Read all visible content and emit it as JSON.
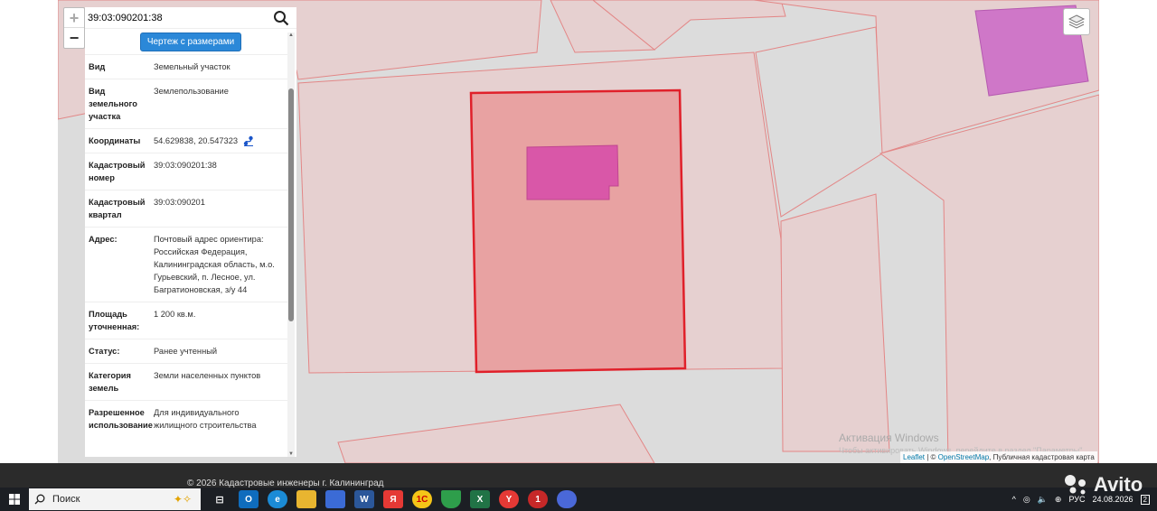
{
  "search": {
    "value": "39:03:090201:38"
  },
  "drawing_button": "Чертеж с размерами",
  "info_rows": [
    {
      "key": "Вид",
      "value": "Земельный участок"
    },
    {
      "key": "Вид земельного участка",
      "value": "Землепользование"
    },
    {
      "key": "Координаты",
      "value": "54.629838, 20.547323"
    },
    {
      "key": "Кадастровый номер",
      "value": "39:03:090201:38"
    },
    {
      "key": "Кадастровый квартал",
      "value": "39:03:090201"
    },
    {
      "key": "Адрес:",
      "value": "Почтовый адрес ориентира: Российская Федерация, Калининградская область, м.о. Гурьевский, п. Лесное, ул. Багратионовская, з/у 44"
    },
    {
      "key": "Площадь уточненная:",
      "value": "1 200 кв.м."
    },
    {
      "key": "Статус:",
      "value": "Ранее учтенный"
    },
    {
      "key": "Категория земель",
      "value": "Земли населенных пунктов"
    },
    {
      "key": "Разрешенное использование",
      "value": "Для индивидуального жилищного строительства"
    }
  ],
  "zoom": {
    "in": "+",
    "out": "−"
  },
  "watermark": {
    "line1": "Активация Windows",
    "line2": "Чтобы активировать Windows, перейдите в раздел \"Параметры\"."
  },
  "attribution": {
    "leaflet": "Leaflet",
    "sep": " | © ",
    "osm": "OpenStreetMap",
    "rest": ", Публичная кадастровая карта"
  },
  "footer_text": "© 2026 Кадастровые инженеры г. Калининград",
  "taskbar": {
    "search_label": "Поиск",
    "lang": "РУС",
    "time": "",
    "date": "24.08.2026",
    "notif_count": "2",
    "apps": [
      {
        "icon": "task-view-icon",
        "label": "",
        "color": "transparent"
      },
      {
        "icon": "outlook-icon",
        "label": "O",
        "color": "#0f6cbd"
      },
      {
        "icon": "edge-icon",
        "label": "e",
        "color": "#1b8bd6"
      },
      {
        "icon": "explorer-icon",
        "label": "",
        "color": "#e8b530"
      },
      {
        "icon": "store-icon",
        "label": "",
        "color": "#3b6bd6"
      },
      {
        "icon": "word-icon",
        "label": "W",
        "color": "#2b579a"
      },
      {
        "icon": "yandex-icon",
        "label": "Я",
        "color": "#e53935"
      },
      {
        "icon": "1c-icon",
        "label": "1С",
        "color": "#f5c518"
      },
      {
        "icon": "shield-icon",
        "label": "",
        "color": "#2e9e4b"
      },
      {
        "icon": "excel-icon",
        "label": "X",
        "color": "#217346"
      },
      {
        "icon": "yandex-browser-icon",
        "label": "Y",
        "color": "#e53935"
      },
      {
        "icon": "notes-icon",
        "label": "1",
        "color": "#c62828"
      },
      {
        "icon": "copilot-icon",
        "label": "",
        "color": "#4a68d8"
      }
    ]
  },
  "brand": "Avito",
  "colors": {
    "selected_border": "#e0202a",
    "selected_fill": "#e79b9b",
    "building_fill": "#d957a8",
    "parcel_fill": "#e9cece",
    "parcel_stroke": "#e08a8a",
    "road": "#dcdcdc"
  }
}
